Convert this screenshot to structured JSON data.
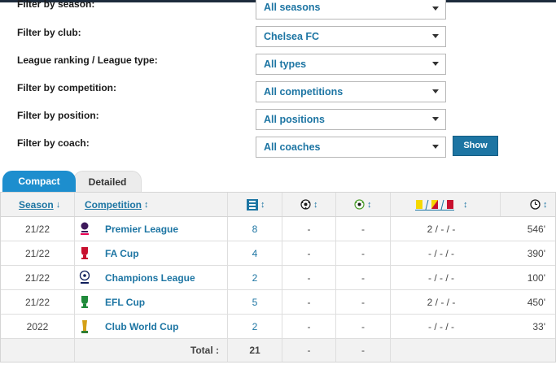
{
  "filters": [
    {
      "label": "Filter by season:",
      "value": "All seasons"
    },
    {
      "label": "Filter by club:",
      "value": "Chelsea FC"
    },
    {
      "label": "League ranking / League type:",
      "value": "All types"
    },
    {
      "label": "Filter by competition:",
      "value": "All competitions"
    },
    {
      "label": "Filter by position:",
      "value": "All positions"
    },
    {
      "label": "Filter by coach:",
      "value": "All coaches"
    }
  ],
  "show_button": "Show",
  "tabs": {
    "compact": "Compact",
    "detailed": "Detailed"
  },
  "table": {
    "headers": {
      "season": "Season",
      "season_sort": "↓",
      "competition": "Competition",
      "competition_sort": "↕",
      "sort": "↕"
    },
    "rows": [
      {
        "season": "21/22",
        "competition": "Premier League",
        "apps": "8",
        "goals": "-",
        "assists": "-",
        "cards": "2 / - / -",
        "minutes": "546'",
        "logo": "premier-league-logo"
      },
      {
        "season": "21/22",
        "competition": "FA Cup",
        "apps": "4",
        "goals": "-",
        "assists": "-",
        "cards": "- / - / -",
        "minutes": "390'",
        "logo": "fa-cup-logo"
      },
      {
        "season": "21/22",
        "competition": "Champions League",
        "apps": "2",
        "goals": "-",
        "assists": "-",
        "cards": "- / - / -",
        "minutes": "100'",
        "logo": "champions-league-logo"
      },
      {
        "season": "21/22",
        "competition": "EFL Cup",
        "apps": "5",
        "goals": "-",
        "assists": "-",
        "cards": "2 / - / -",
        "minutes": "450'",
        "logo": "efl-cup-logo"
      },
      {
        "season": "2022",
        "competition": "Club World Cup",
        "apps": "2",
        "goals": "-",
        "assists": "-",
        "cards": "- / - / -",
        "minutes": "33'",
        "logo": "club-world-cup-logo"
      }
    ],
    "total": {
      "label": "Total :",
      "apps": "21",
      "goals": "-",
      "assists": "-"
    }
  },
  "colors": {
    "accent": "#1d75a3",
    "tab_active": "#1d8ece",
    "card_yellow": "#f5d800",
    "card_red": "#c8102e"
  }
}
